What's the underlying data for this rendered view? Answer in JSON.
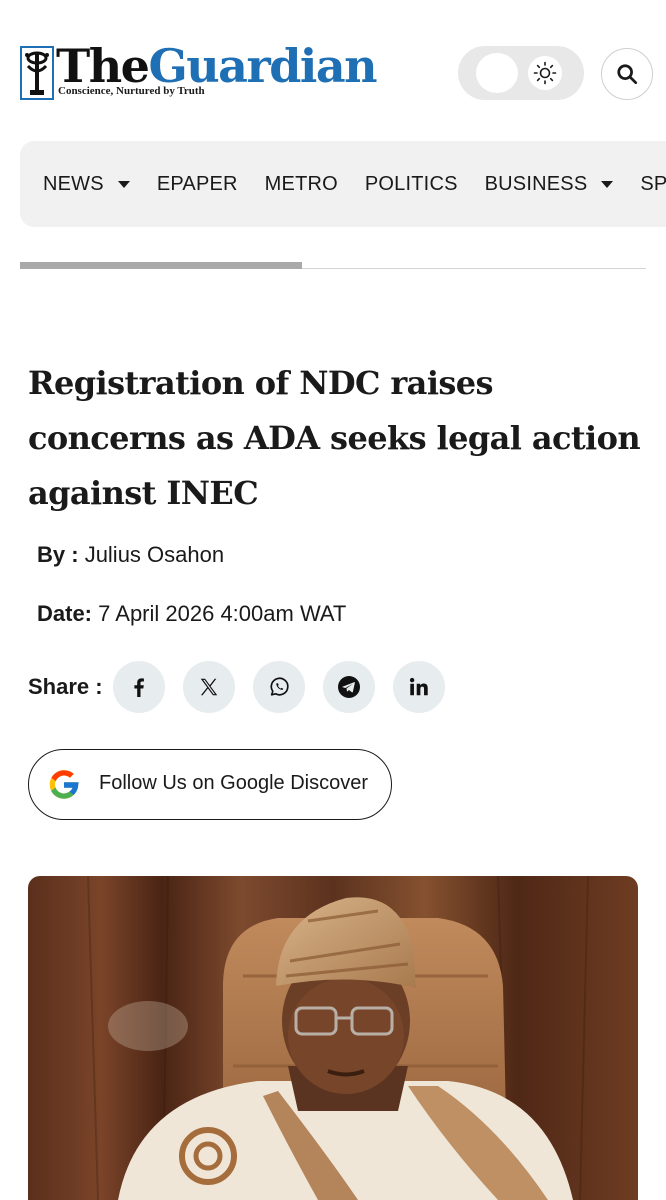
{
  "header": {
    "logo_the": "The",
    "logo_guardian": "Guardian",
    "tagline": "Conscience, Nurtured by Truth",
    "theme_toggle_icon": "sun-icon",
    "search_icon": "search-icon"
  },
  "nav": {
    "items": [
      {
        "label": "NEWS",
        "has_dropdown": true
      },
      {
        "label": "EPAPER",
        "has_dropdown": false
      },
      {
        "label": "METRO",
        "has_dropdown": false
      },
      {
        "label": "POLITICS",
        "has_dropdown": false
      },
      {
        "label": "BUSINESS",
        "has_dropdown": true
      },
      {
        "label": "SPORT",
        "has_dropdown": false
      }
    ]
  },
  "reading_progress": 0.45,
  "article": {
    "headline": "Registration of NDC raises concerns as ADA seeks legal action against INEC",
    "byline_label": "By :",
    "author": "Julius Osahon",
    "date_label": "Date:",
    "date": "7 April 2026 4:00am WAT",
    "share_label": "Share :",
    "share_buttons": [
      {
        "icon": "facebook-icon"
      },
      {
        "icon": "x-twitter-icon"
      },
      {
        "icon": "whatsapp-icon"
      },
      {
        "icon": "telegram-icon"
      },
      {
        "icon": "linkedin-icon"
      }
    ],
    "google_discover_label": "Follow Us on Google Discover"
  },
  "colors": {
    "brand_blue": "#1f6fb5",
    "nav_bg": "#f1f1f1",
    "share_bg": "#e7ecee"
  }
}
